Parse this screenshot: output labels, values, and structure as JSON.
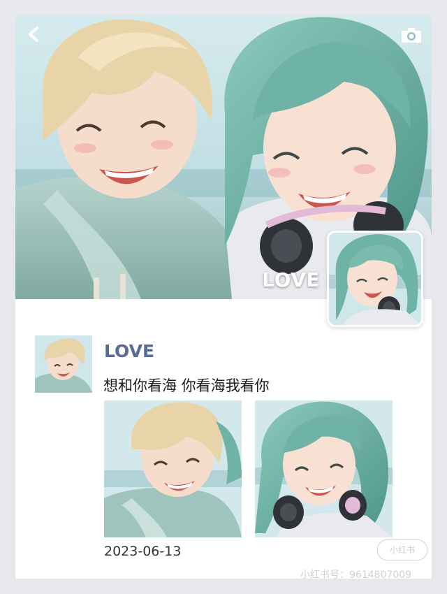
{
  "cover": {
    "name": "LOVE"
  },
  "icons": {
    "back": "back-chevron-icon",
    "camera": "camera-icon"
  },
  "post": {
    "author": "LOVE",
    "text": "想和你看海 你看海我看你",
    "date": "2023-06-13",
    "images": [
      "boy-portrait",
      "girl-portrait"
    ]
  },
  "watermark": {
    "badge": "小红书",
    "id": "小红书号：9614807009"
  },
  "colors": {
    "author_name": "#576b95",
    "boy_hair": "#e8d4a8",
    "girl_hair": "#6fb3a6",
    "hoodie": "#9fc4bd"
  }
}
